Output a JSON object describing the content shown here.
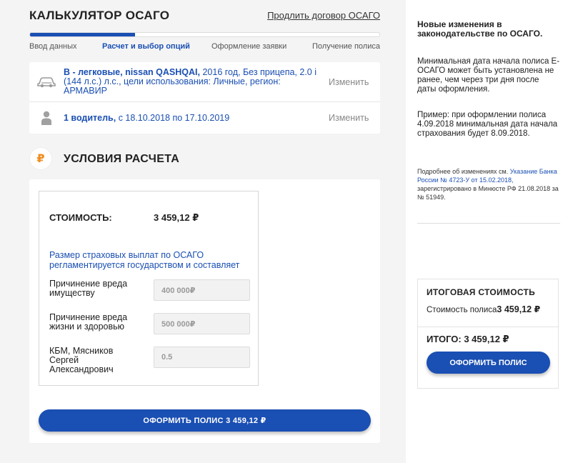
{
  "header": {
    "title": "КАЛЬКУЛЯТОР ОСАГО",
    "renew_link": "Продлить договор ОСАГО"
  },
  "progress": {
    "value_percent": 30,
    "steps": [
      {
        "label": "Ввод данных",
        "active": false
      },
      {
        "label": "Расчет и выбор опций",
        "active": true
      },
      {
        "label": "Оформление заявки",
        "active": false
      },
      {
        "label": "Получение полиса",
        "active": false
      }
    ]
  },
  "vehicle": {
    "category": "B - легковые,",
    "make": "nissan",
    "model": "QASHQAI,",
    "details": "2016 год, Без прицепа, 2.0 i (144 л.с.) л.с., цели использования: Личные, регион: АРМАВИР",
    "action": "Изменить",
    "icon": "car-icon"
  },
  "driver": {
    "count": "1 водитель,",
    "period": "с 18.10.2018 по 17.10.2019",
    "action": "Изменить",
    "icon": "person-icon"
  },
  "conditions": {
    "icon_glyph": "₽",
    "title": "УСЛОВИЯ РАСЧЕТА",
    "cost_label": "СТОИМОСТЬ:",
    "cost_value": "3 459,12 ₽",
    "info": "Размер страховых выплат по ОСАГО регламентируется государством и составляет",
    "fields": [
      {
        "label": "Причинение вреда имуществу",
        "value": "400 000₽"
      },
      {
        "label": "Причинение вреда жизни и здоровью",
        "value": "500 000₽"
      },
      {
        "label": "КБМ, Мясников Сергей Александрович",
        "value": "0.5"
      }
    ],
    "button": "ОФОРМИТЬ ПОЛИС 3 459,12 ₽"
  },
  "sidebar": {
    "heading": "Новые изменения в законодательстве по ОСАГО.",
    "p1": "Минимальная дата начала полиса Е-ОСАГО может быть установлена не ранее, чем через три дня после даты оформления.",
    "p2": "Пример: при оформлении полиса 4.09.2018 минимальная дата начала страхования будет 8.09.2018.",
    "small_prefix": "Подробнее об изменениях см.",
    "small_link": "Указание Банка России № 4723-У от 15.02.2018,",
    "small_suffix": "зарегистрировано в Минюсте РФ 21.08.2018 за № 51949."
  },
  "total": {
    "title": "ИТОГОВАЯ СТОИМОСТЬ",
    "sub_label": "Стоимость полиса",
    "sub_value": "3 459,12 ₽",
    "grand": "ИТОГО: 3 459,12 ₽",
    "button": "ОФОРМИТЬ ПОЛИС"
  },
  "colors": {
    "accent": "#1a4fb3",
    "ruble_icon": "#f08c1e"
  }
}
